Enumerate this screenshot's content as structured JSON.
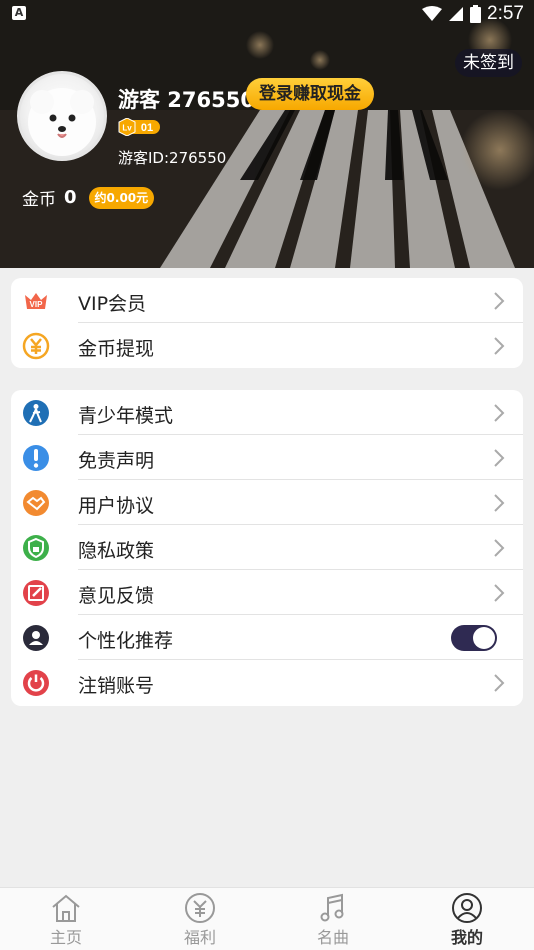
{
  "status_bar": {
    "time": "2:57"
  },
  "header": {
    "signin_badge": "未签到",
    "username": "游客 276550",
    "login_button": "登录赚取现金",
    "level": "01",
    "user_id": "游客ID:276550",
    "coins_label": "金币",
    "coins_value": "0",
    "coins_approx": "约0.00元"
  },
  "menu_group_1": [
    {
      "label": "VIP会员",
      "icon": "vip-crown-icon",
      "color": "#f2664a"
    },
    {
      "label": "金币提现",
      "icon": "yen-coin-icon",
      "color": "#f5a623"
    }
  ],
  "menu_group_2": [
    {
      "label": "青少年模式",
      "icon": "child-icon",
      "color": "#1f6fb5"
    },
    {
      "label": "免责声明",
      "icon": "exclamation-icon",
      "color": "#3a8ee6"
    },
    {
      "label": "用户协议",
      "icon": "handshake-icon",
      "color": "#f28a30"
    },
    {
      "label": "隐私政策",
      "icon": "shield-lock-icon",
      "color": "#3db04a"
    },
    {
      "label": "意见反馈",
      "icon": "edit-icon",
      "color": "#e2424a"
    },
    {
      "label": "个性化推荐",
      "icon": "user-icon",
      "color": "#2a2a3a",
      "toggle_on": true
    },
    {
      "label": "注销账号",
      "icon": "power-icon",
      "color": "#e2424a"
    }
  ],
  "bottom_nav": [
    {
      "label": "主页",
      "icon": "home-icon"
    },
    {
      "label": "福利",
      "icon": "yen-circle-icon"
    },
    {
      "label": "名曲",
      "icon": "music-note-icon"
    },
    {
      "label": "我的",
      "icon": "profile-icon",
      "active": true
    }
  ]
}
